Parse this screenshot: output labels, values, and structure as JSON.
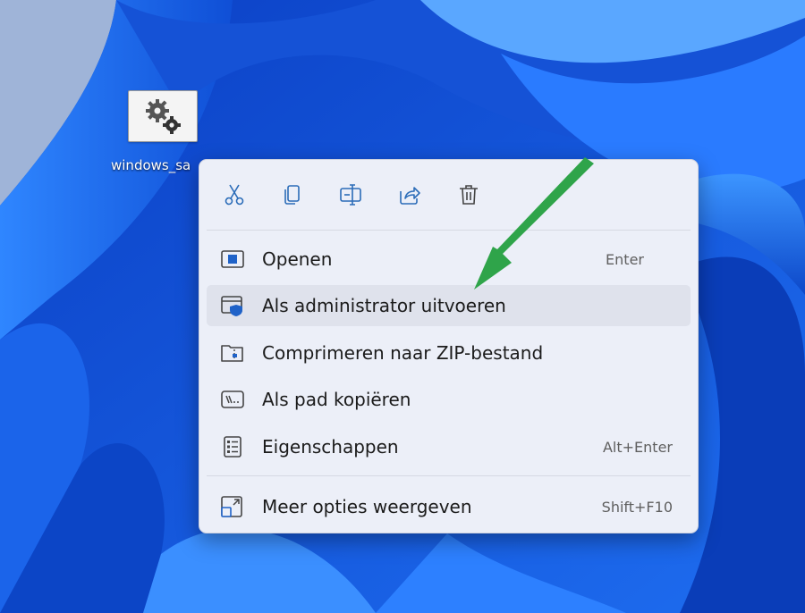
{
  "desktop": {
    "file_label": "windows_sa",
    "file_icon": "gears-icon"
  },
  "context_menu": {
    "toolbar": [
      {
        "name": "cut-icon"
      },
      {
        "name": "copy-icon"
      },
      {
        "name": "rename-icon"
      },
      {
        "name": "share-icon"
      },
      {
        "name": "delete-icon"
      }
    ],
    "items": [
      {
        "label": "Openen",
        "shortcut": "Enter",
        "icon": "open-icon"
      },
      {
        "label": "Als administrator uitvoeren",
        "shortcut": "",
        "icon": "shield-window-icon"
      },
      {
        "label": "Comprimeren naar ZIP-bestand",
        "shortcut": "",
        "icon": "zip-folder-icon"
      },
      {
        "label": "Als pad kopiëren",
        "shortcut": "",
        "icon": "copy-path-icon"
      },
      {
        "label": "Eigenschappen",
        "shortcut": "Alt+Enter",
        "icon": "properties-icon"
      }
    ],
    "more": {
      "label": "Meer opties weergeven",
      "shortcut": "Shift+F10",
      "icon": "more-options-icon"
    }
  },
  "annotation": {
    "arrow_color": "#2fa44a"
  }
}
